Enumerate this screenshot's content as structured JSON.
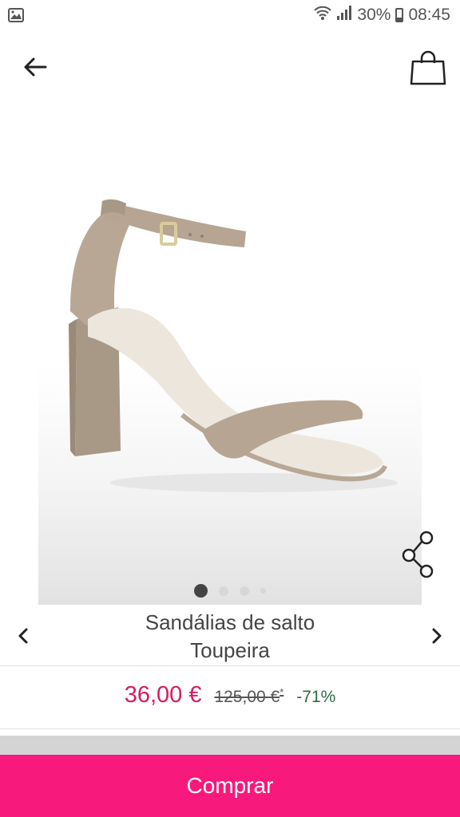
{
  "status_bar": {
    "battery_percent": "30%",
    "time": "08:45",
    "icons": [
      "image-notification-icon",
      "wifi-icon",
      "signal-icon",
      "battery-icon"
    ]
  },
  "top_bar": {
    "icons": [
      "back-arrow-icon",
      "shopping-bag-icon"
    ]
  },
  "product": {
    "title_line1": "Sandálias de salto",
    "title_line2": "Toupeira",
    "image_count": 4,
    "active_image": 1,
    "price": "36,00 €",
    "old_price": "125,00 €",
    "old_price_mark": "*",
    "discount": "-71%"
  },
  "actions": {
    "buy_label": "Comprar",
    "icons": [
      "share-icon",
      "chevron-left-icon",
      "chevron-right-icon"
    ]
  },
  "colors": {
    "accent": "#f7197c",
    "price": "#d81b60",
    "discount": "#2e6b45"
  }
}
